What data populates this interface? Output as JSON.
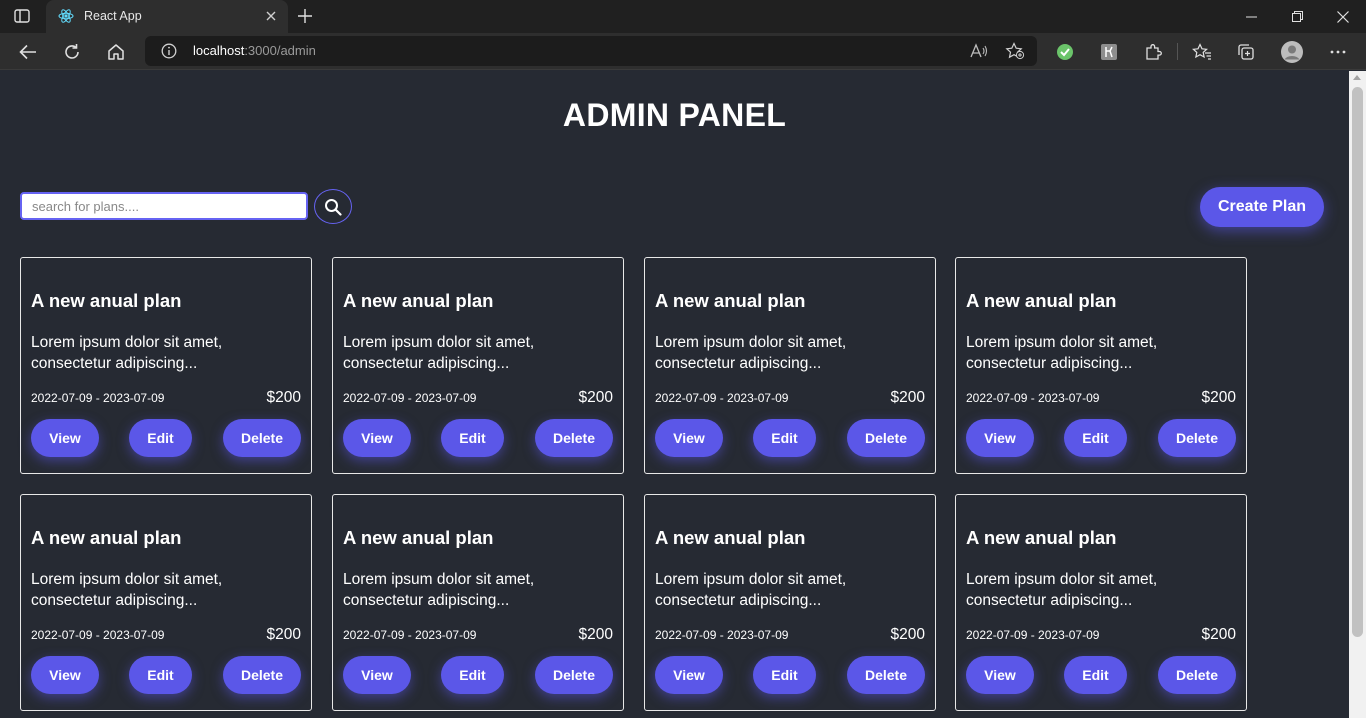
{
  "browser": {
    "tab_title": "React App",
    "url_host": "localhost",
    "url_rest": ":3000/admin"
  },
  "page": {
    "title": "ADMIN PANEL",
    "search_placeholder": "search for plans....",
    "create_label": "Create Plan"
  },
  "colors": {
    "accent": "#5b57e8",
    "background": "#262a33",
    "card_border": "#e8e8e8"
  },
  "plans": [
    {
      "title": "A new anual plan",
      "description": "Lorem ipsum dolor sit amet, consectetur adipiscing...",
      "dates": "2022-07-09 - 2023-07-09",
      "price": "$200",
      "view": "View",
      "edit": "Edit",
      "delete": "Delete"
    },
    {
      "title": "A new anual plan",
      "description": "Lorem ipsum dolor sit amet, consectetur adipiscing...",
      "dates": "2022-07-09 - 2023-07-09",
      "price": "$200",
      "view": "View",
      "edit": "Edit",
      "delete": "Delete"
    },
    {
      "title": "A new anual plan",
      "description": "Lorem ipsum dolor sit amet, consectetur adipiscing...",
      "dates": "2022-07-09 - 2023-07-09",
      "price": "$200",
      "view": "View",
      "edit": "Edit",
      "delete": "Delete"
    },
    {
      "title": "A new anual plan",
      "description": "Lorem ipsum dolor sit amet, consectetur adipiscing...",
      "dates": "2022-07-09 - 2023-07-09",
      "price": "$200",
      "view": "View",
      "edit": "Edit",
      "delete": "Delete"
    },
    {
      "title": "A new anual plan",
      "description": "Lorem ipsum dolor sit amet, consectetur adipiscing...",
      "dates": "2022-07-09 - 2023-07-09",
      "price": "$200",
      "view": "View",
      "edit": "Edit",
      "delete": "Delete"
    },
    {
      "title": "A new anual plan",
      "description": "Lorem ipsum dolor sit amet, consectetur adipiscing...",
      "dates": "2022-07-09 - 2023-07-09",
      "price": "$200",
      "view": "View",
      "edit": "Edit",
      "delete": "Delete"
    },
    {
      "title": "A new anual plan",
      "description": "Lorem ipsum dolor sit amet, consectetur adipiscing...",
      "dates": "2022-07-09 - 2023-07-09",
      "price": "$200",
      "view": "View",
      "edit": "Edit",
      "delete": "Delete"
    },
    {
      "title": "A new anual plan",
      "description": "Lorem ipsum dolor sit amet, consectetur adipiscing...",
      "dates": "2022-07-09 - 2023-07-09",
      "price": "$200",
      "view": "View",
      "edit": "Edit",
      "delete": "Delete"
    }
  ]
}
